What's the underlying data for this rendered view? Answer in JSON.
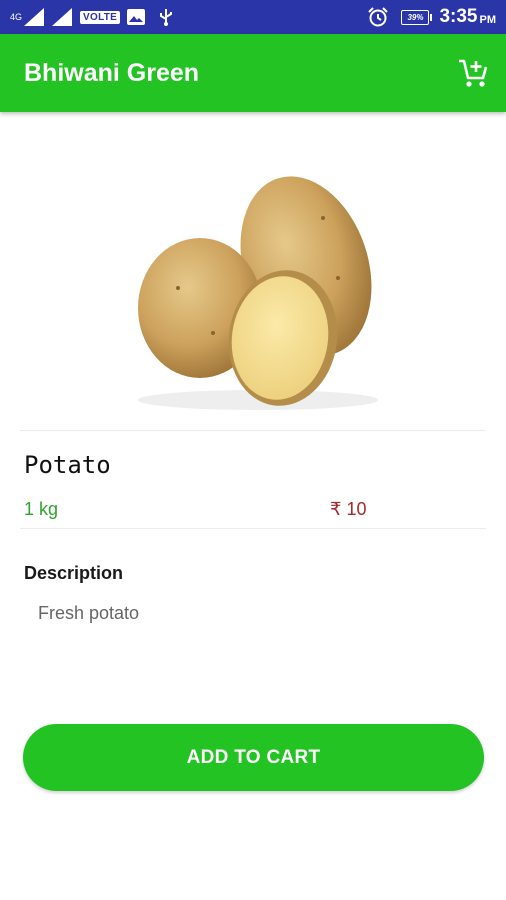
{
  "status_bar": {
    "network": "4G",
    "volte": "VOLTE",
    "battery": "39%",
    "time": "3:35",
    "ampm": "PM",
    "icons": [
      "signal-icon",
      "signal-icon",
      "image-icon",
      "usb-icon",
      "alarm-icon",
      "battery-icon"
    ]
  },
  "app_bar": {
    "title": "Bhiwani Green",
    "cart_icon": "add-to-cart-icon",
    "color": "#22c322"
  },
  "product": {
    "name": "Potato",
    "quantity": "1 kg",
    "price": "₹ 10",
    "image": "potato-image"
  },
  "description": {
    "title": "Description",
    "text": "Fresh potato"
  },
  "actions": {
    "add_to_cart": "ADD TO CART"
  },
  "colors": {
    "status_bar": "#2a35a8",
    "primary": "#22c322",
    "quantity": "#2ea52e",
    "price": "#a52a2a"
  }
}
